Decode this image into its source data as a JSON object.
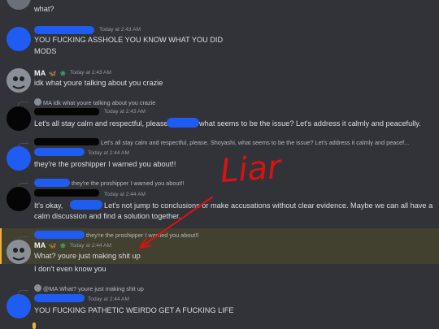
{
  "messages": [
    {
      "text": "what?"
    },
    {
      "timestamp": "Today at 2:43 AM",
      "lines": [
        "YOU FUCKING ASSHOLE YOU KNOW WHAT YOU DID",
        "MODS"
      ]
    },
    {
      "username": "MA",
      "timestamp": "Today at 2:43 AM",
      "text": "idk what youre talking about you crazie"
    },
    {
      "reply": "MA idk what youre talking about you crazie",
      "timestamp": "Today at 2:43 AM",
      "text_a": "Let's all stay calm and respectful, please.",
      "text_b": "what seems to be the issue? Let's address it calmly and peacefully."
    },
    {
      "reply": "Let's all stay calm and respectful, please. Shoyashi, what seems to be the issue? Let's address it calmly and peacef...",
      "timestamp": "Today at 2:44 AM",
      "text": "they're the proshipper I warned you about!!"
    },
    {
      "reply": "they're the proshipper I warned you about!!",
      "timestamp": "Today at 2:44 AM",
      "text_a": "It's okay,",
      "text_b": "Let's not jump to conclusions or make accusations without clear evidence. Maybe we can all have a",
      "text_c": "calm discussion and find a solution together."
    },
    {
      "reply": "they're the proshipper I warned you about!!",
      "username": "MA",
      "timestamp": "Today at 2:44 AM",
      "text": "What? youre just making shit up",
      "text2": "I don't even know you"
    },
    {
      "reply": "@MA What? youre just making shit up",
      "timestamp": "Today at 2:44 AM",
      "text": "YOU FUCKING PATHETIC WEIRDO GET A FUCKING LIFE"
    }
  ],
  "annotation": {
    "text": "Liar",
    "color": "#e01010"
  },
  "colors": {
    "background": "#313338",
    "redaction": "#1f5cf2",
    "highlight": "#42402f"
  }
}
